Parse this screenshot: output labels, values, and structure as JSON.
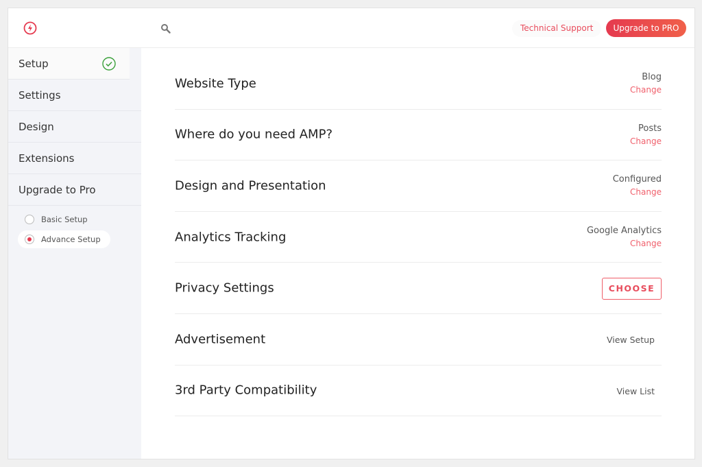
{
  "header": {
    "technical_support": "Technical Support",
    "upgrade_button": "Upgrade to PRO",
    "accent": "#e53a4f"
  },
  "sidebar": {
    "items": [
      {
        "label": "Setup",
        "completed": true
      },
      {
        "label": "Settings"
      },
      {
        "label": "Design"
      },
      {
        "label": "Extensions"
      },
      {
        "label": "Upgrade to Pro"
      }
    ],
    "setup_modes": [
      {
        "label": "Basic Setup",
        "selected": false
      },
      {
        "label": "Advance Setup",
        "selected": true
      }
    ]
  },
  "rows": [
    {
      "title": "Website Type",
      "value": "Blog",
      "action": "Change"
    },
    {
      "title": "Where do you need AMP?",
      "value": "Posts",
      "action": "Change"
    },
    {
      "title": "Design and Presentation",
      "value": "Configured",
      "action": "Change"
    },
    {
      "title": "Analytics Tracking",
      "value": "Google Analytics",
      "action": "Change"
    },
    {
      "title": "Privacy Settings",
      "action": "CHOOSE"
    },
    {
      "title": "Advertisement",
      "action": "View Setup"
    },
    {
      "title": "3rd Party Compatibility",
      "action": "View List"
    }
  ]
}
